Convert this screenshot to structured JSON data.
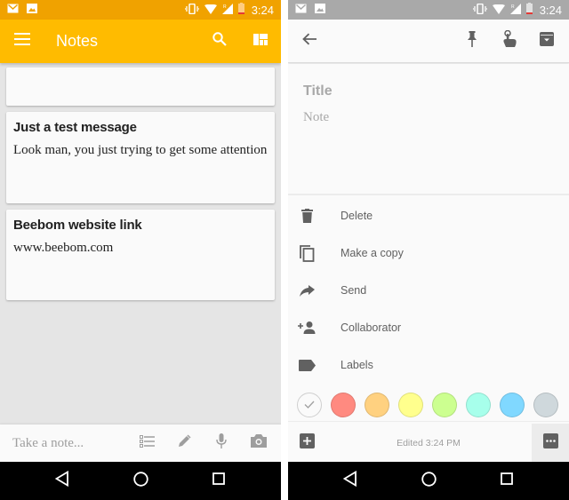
{
  "status_bar": {
    "time": "3:24",
    "left_icons": [
      "gmail-icon",
      "image-icon"
    ],
    "right_icons": [
      "vibrate-icon",
      "wifi-icon",
      "signal-roaming-icon",
      "battery-low-icon"
    ]
  },
  "left_screen": {
    "app_title": "Notes",
    "toolbar_icons": [
      "menu-icon",
      "search-icon",
      "layout-toggle-icon"
    ],
    "notes": [
      {
        "title": "",
        "body": ""
      },
      {
        "title": "Just a test message",
        "body": "Look man, you just trying to get some attention"
      },
      {
        "title": "Beebom website link",
        "body": "www.beebom.com"
      }
    ],
    "take_note_placeholder": "Take a note...",
    "take_note_actions": [
      "checklist-icon",
      "pen-icon",
      "mic-icon",
      "camera-icon"
    ]
  },
  "right_screen": {
    "toolbar_icons": [
      "back-arrow-icon",
      "pin-icon",
      "reminder-touch-icon",
      "archive-icon"
    ],
    "title_placeholder": "Title",
    "note_placeholder": "Note",
    "menu_items": [
      {
        "label": "Delete",
        "icon": "trash-icon"
      },
      {
        "label": "Make a copy",
        "icon": "copy-icon"
      },
      {
        "label": "Send",
        "icon": "send-icon"
      },
      {
        "label": "Collaborator",
        "icon": "add-person-icon"
      },
      {
        "label": "Labels",
        "icon": "label-icon"
      }
    ],
    "colors": [
      {
        "name": "white",
        "hex": "#fafafa",
        "selected": true
      },
      {
        "name": "red",
        "hex": "#ff8a80",
        "selected": false
      },
      {
        "name": "orange",
        "hex": "#ffd180",
        "selected": false
      },
      {
        "name": "yellow",
        "hex": "#ffff8d",
        "selected": false
      },
      {
        "name": "green",
        "hex": "#ccff90",
        "selected": false
      },
      {
        "name": "teal",
        "hex": "#a7ffeb",
        "selected": false
      },
      {
        "name": "blue",
        "hex": "#80d8ff",
        "selected": false
      },
      {
        "name": "gray",
        "hex": "#cfd8dc",
        "selected": false
      }
    ],
    "edited_text": "Edited 3:24 PM"
  },
  "nav_bar": [
    "back-icon",
    "home-icon",
    "recents-icon"
  ],
  "theme": {
    "accent": "#ffbb00",
    "accent_dark": "#f0a200",
    "icon_gray": "#616161"
  }
}
